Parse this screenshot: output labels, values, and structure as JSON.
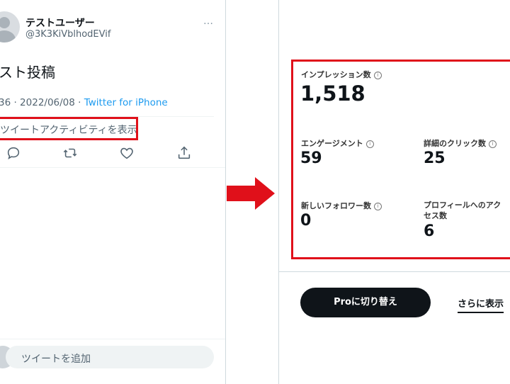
{
  "tweet": {
    "user_name": "テストユーザー",
    "user_handle": "@3K3KiVblhodEVif",
    "more": "…",
    "text": "スト投稿",
    "meta_time": "36 · 2022/06/08 · ",
    "meta_source": "Twitter for iPhone",
    "activity_link": "ツイートアクティビティを表示",
    "reply_placeholder": "ツイートを追加"
  },
  "analytics": {
    "impressions_label": "インプレッション数",
    "impressions_value": "1,518",
    "engagement_label": "エンゲージメント",
    "engagement_value": "59",
    "detail_clicks_label": "詳細のクリック数",
    "detail_clicks_value": "25",
    "new_followers_label": "新しいフォロワー数",
    "new_followers_value": "0",
    "profile_visits_label_1": "プロフィールへのアク",
    "profile_visits_label_2": "セス数",
    "profile_visits_value": "6",
    "pro_button_label": "Proに切り替え",
    "more_label": "さらに表示"
  },
  "colors": {
    "highlight": "#e0101a",
    "link": "#1d9bf0"
  }
}
